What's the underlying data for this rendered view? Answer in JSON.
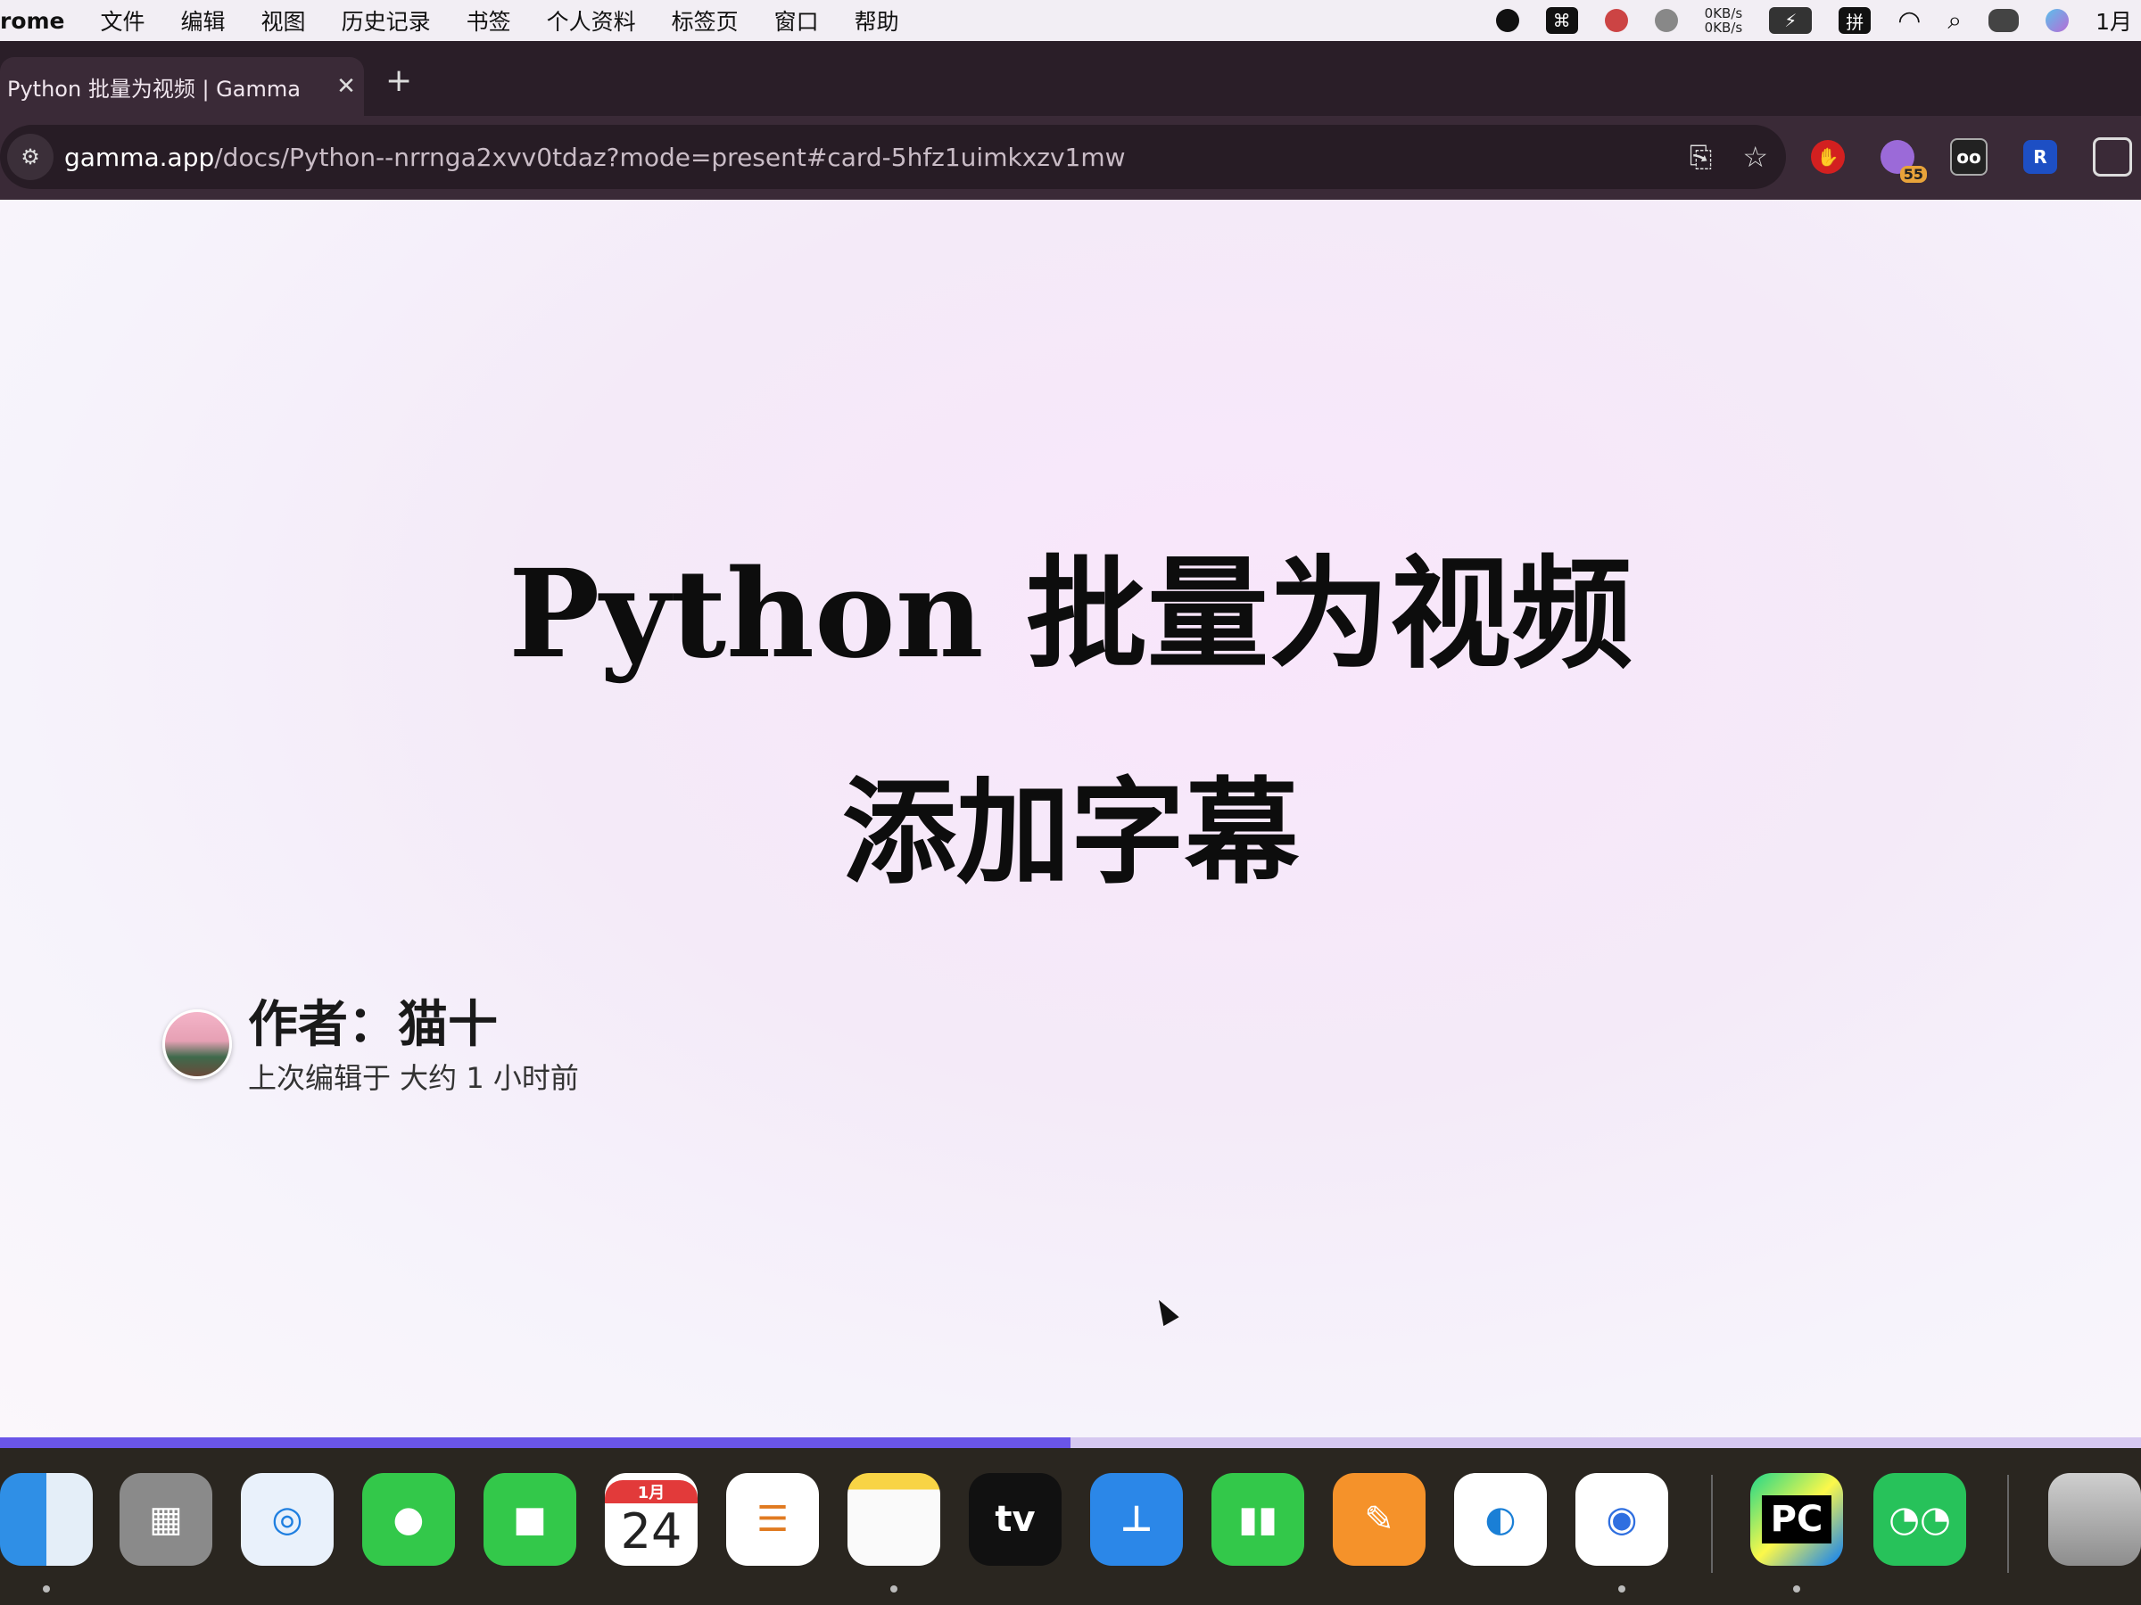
{
  "menubar": {
    "app": "rome",
    "items": [
      "文件",
      "编辑",
      "视图",
      "历史记录",
      "书签",
      "个人资料",
      "标签页",
      "窗口",
      "帮助"
    ],
    "net_up": "0KB/s",
    "net_down": "0KB/s",
    "ime": "拼",
    "date": "1月"
  },
  "tab": {
    "title": "Python 批量为视频 | Gamma",
    "close": "✕",
    "new_tab": "+"
  },
  "address_bar": {
    "host": "gamma.app",
    "path": "/docs/Python--nrrnga2xvv0tdaz?mode=present#card-5hfz1uimkxzv1mw"
  },
  "extensions": {
    "badge_count": "55"
  },
  "slide": {
    "title": "Python 批量为视频",
    "subtitle": "添加字幕",
    "author": "作者：猫十",
    "edited": "上次编辑于 大约 1 小时前"
  },
  "progress": {
    "fraction": 0.5
  },
  "dock": {
    "calendar_month": "1月",
    "calendar_day": "24",
    "tv_label": "tv",
    "pycharm_label": "PC"
  },
  "colors": {
    "accent_progress": "#6a55e8",
    "tab_bg": "#3a2a37"
  }
}
